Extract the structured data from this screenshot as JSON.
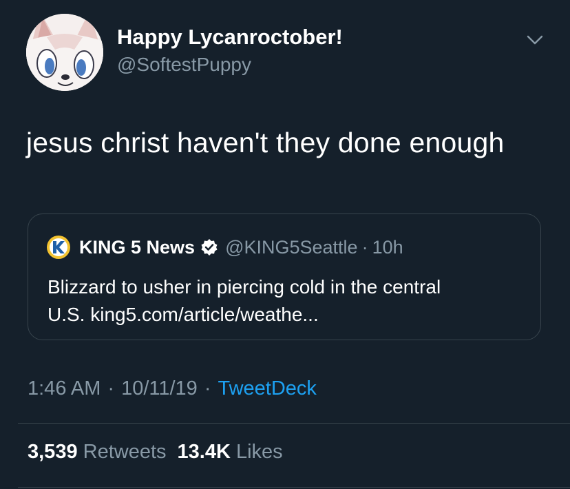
{
  "user": {
    "display_name": "Happy Lycanroctober!",
    "handle": "@SoftestPuppy"
  },
  "tweet": {
    "text": "jesus christ haven't they done enough"
  },
  "quoted_tweet": {
    "name": "KING 5 News",
    "handle": "@KING5Seattle",
    "separator": "·",
    "time": "10h",
    "text_line1": "Blizzard to usher in piercing cold in the central",
    "text_line2": "U.S. king5.com/article/weathe..."
  },
  "meta": {
    "time": "1:46 AM",
    "separator": "·",
    "date": "10/11/19",
    "source": "TweetDeck"
  },
  "stats": {
    "retweets_count": "3,539",
    "retweets_label": "Retweets",
    "likes_count": "13.4K",
    "likes_label": "Likes"
  },
  "colors": {
    "background": "#15202b",
    "secondary_text": "#8899a6",
    "link": "#1da1f2",
    "border": "#38444d"
  },
  "icons": {
    "avatar": "lycanroc-avatar",
    "menu": "chevron-down-icon",
    "verified": "verified-badge-icon",
    "quote_logo": "king5-logo"
  }
}
